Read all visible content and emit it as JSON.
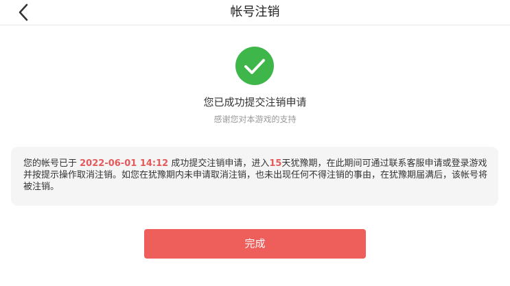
{
  "nav": {
    "title": "帐号注销"
  },
  "result": {
    "title": "您已成功提交注销申请",
    "subtitle": "感谢您对本游戏的支持",
    "icon": "check-circle-icon",
    "icon_color": "#3fb64a"
  },
  "notice": {
    "part1": "您的帐号已于 ",
    "datetime": "2022-06-01 14:12",
    "part2": "  成功提交注销申请，进入",
    "days": "15",
    "part3": "天犹豫期，在此期间可通过联系客服申请或登录游戏并按提示操作取消注销。如您在犹豫期内未申请取消注销，也未出现任何不得注销的事由，在犹豫期届满后，该帐号将被注销。",
    "highlight_color": "#e5595b"
  },
  "footer": {
    "done_label": "完成",
    "button_color": "#ee5e5a"
  }
}
